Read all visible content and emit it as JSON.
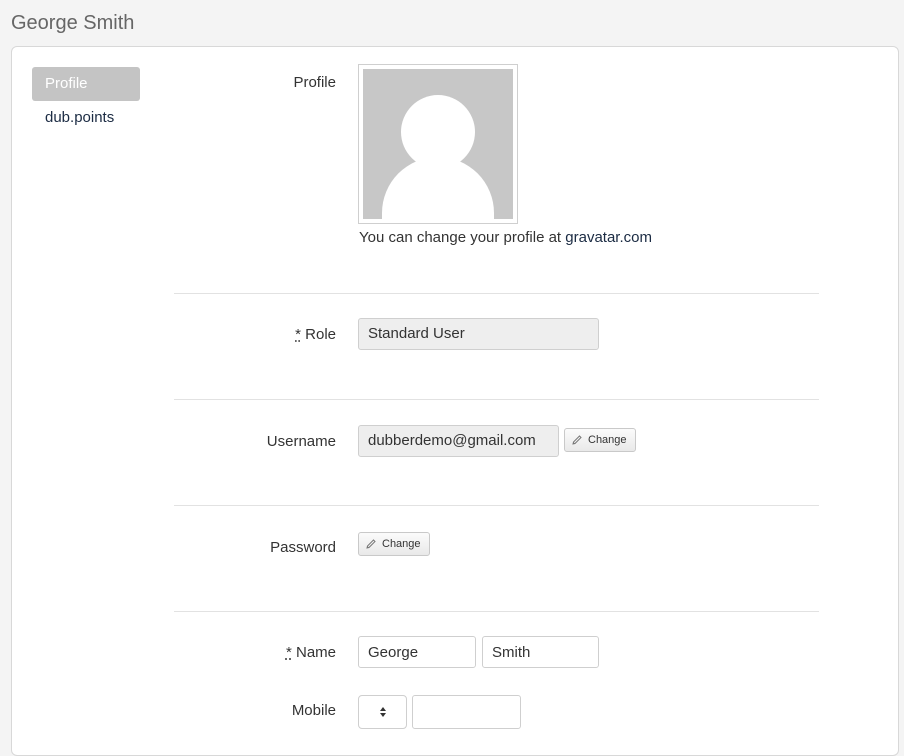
{
  "page": {
    "title": "George Smith"
  },
  "sidebar": {
    "items": [
      {
        "label": "Profile",
        "active": true
      },
      {
        "label": "dub.points",
        "active": false
      }
    ]
  },
  "form": {
    "profile": {
      "label": "Profile",
      "avatar_icon": "default-avatar-silhouette",
      "note_prefix": "You can change your profile at ",
      "note_link": "gravatar.com"
    },
    "role": {
      "required_mark": "*",
      "label": "Role",
      "value": "Standard User"
    },
    "username": {
      "label": "Username",
      "value": "dubberdemo@gmail.com",
      "change_label": "Change"
    },
    "password": {
      "label": "Password",
      "change_label": "Change"
    },
    "name": {
      "required_mark": "*",
      "label": "Name",
      "first": "George",
      "last": "Smith"
    },
    "mobile": {
      "label": "Mobile",
      "country_code": "",
      "number": ""
    }
  },
  "icons": {
    "edit": "pencil-icon",
    "select_arrows": "up-down-caret-icon"
  }
}
